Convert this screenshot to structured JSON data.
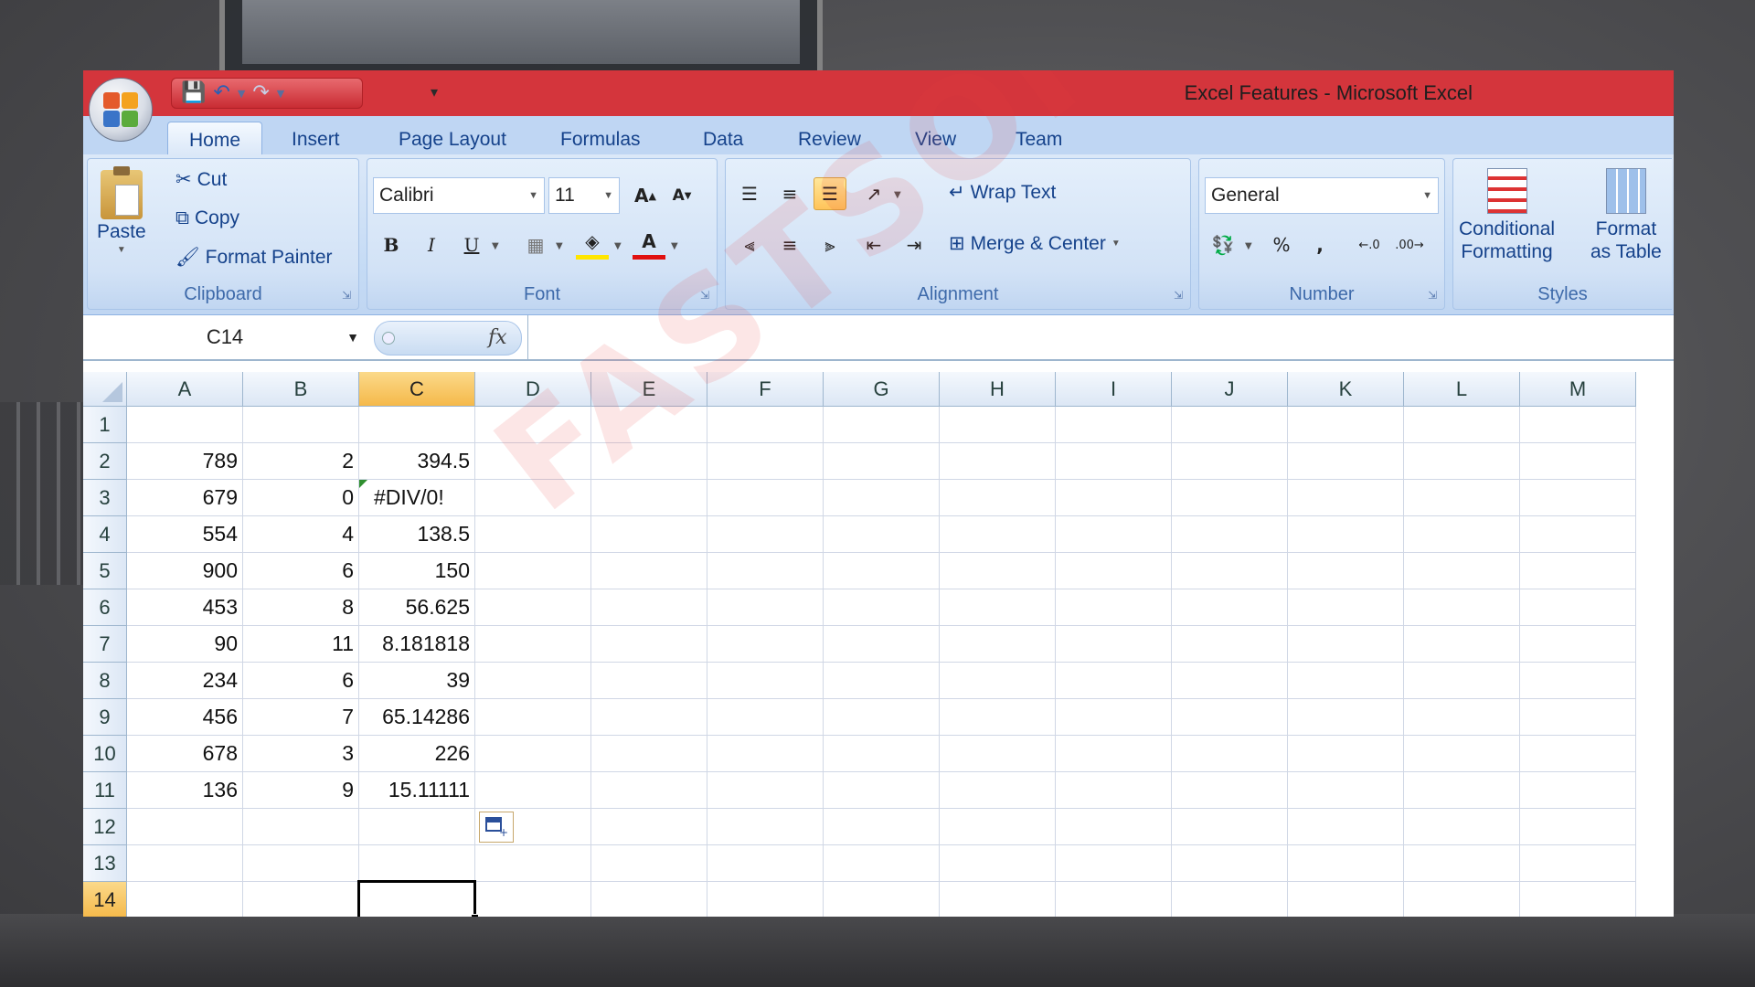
{
  "window": {
    "title": "Excel Features - Microsoft Excel"
  },
  "tabs": [
    "Home",
    "Insert",
    "Page Layout",
    "Formulas",
    "Data",
    "Review",
    "View",
    "Team"
  ],
  "clipboard": {
    "paste": "Paste",
    "cut": "Cut",
    "copy": "Copy",
    "format_painter": "Format Painter",
    "label": "Clipboard"
  },
  "font": {
    "name": "Calibri",
    "size": "11",
    "bold": "B",
    "italic": "I",
    "underline": "U",
    "label": "Font"
  },
  "alignment": {
    "wrap_text": "Wrap Text",
    "merge_center": "Merge & Center",
    "label": "Alignment"
  },
  "number": {
    "format": "General",
    "percent": "%",
    "comma": ",",
    "label": "Number"
  },
  "styles": {
    "conditional_line1": "Conditional",
    "conditional_line2": "Formatting",
    "format_table_line1": "Format",
    "format_table_line2": "as Table",
    "label": "Styles"
  },
  "formula_bar": {
    "name_box": "C14",
    "fx": "fx",
    "value": ""
  },
  "columns": [
    "A",
    "B",
    "C",
    "D",
    "E",
    "F",
    "G",
    "H",
    "I",
    "J",
    "K",
    "L",
    "M"
  ],
  "rows": [
    {
      "n": "1",
      "a": "",
      "b": "",
      "c": ""
    },
    {
      "n": "2",
      "a": "789",
      "b": "2",
      "c": "394.5"
    },
    {
      "n": "3",
      "a": "679",
      "b": "0",
      "c": "#DIV/0!"
    },
    {
      "n": "4",
      "a": "554",
      "b": "4",
      "c": "138.5"
    },
    {
      "n": "5",
      "a": "900",
      "b": "6",
      "c": "150"
    },
    {
      "n": "6",
      "a": "453",
      "b": "8",
      "c": "56.625"
    },
    {
      "n": "7",
      "a": "90",
      "b": "11",
      "c": "8.181818"
    },
    {
      "n": "8",
      "a": "234",
      "b": "6",
      "c": "39"
    },
    {
      "n": "9",
      "a": "456",
      "b": "7",
      "c": "65.14286"
    },
    {
      "n": "10",
      "a": "678",
      "b": "3",
      "c": "226"
    },
    {
      "n": "11",
      "a": "136",
      "b": "9",
      "c": "15.11111"
    },
    {
      "n": "12",
      "a": "",
      "b": "",
      "c": ""
    },
    {
      "n": "13",
      "a": "",
      "b": "",
      "c": ""
    },
    {
      "n": "14",
      "a": "",
      "b": "",
      "c": ""
    }
  ],
  "watermark": "FASTSOFTWARE",
  "colors": {
    "title_bar": "#d4353c",
    "ribbon": "#c5dbf5",
    "selected_header": "#f5b94a"
  }
}
